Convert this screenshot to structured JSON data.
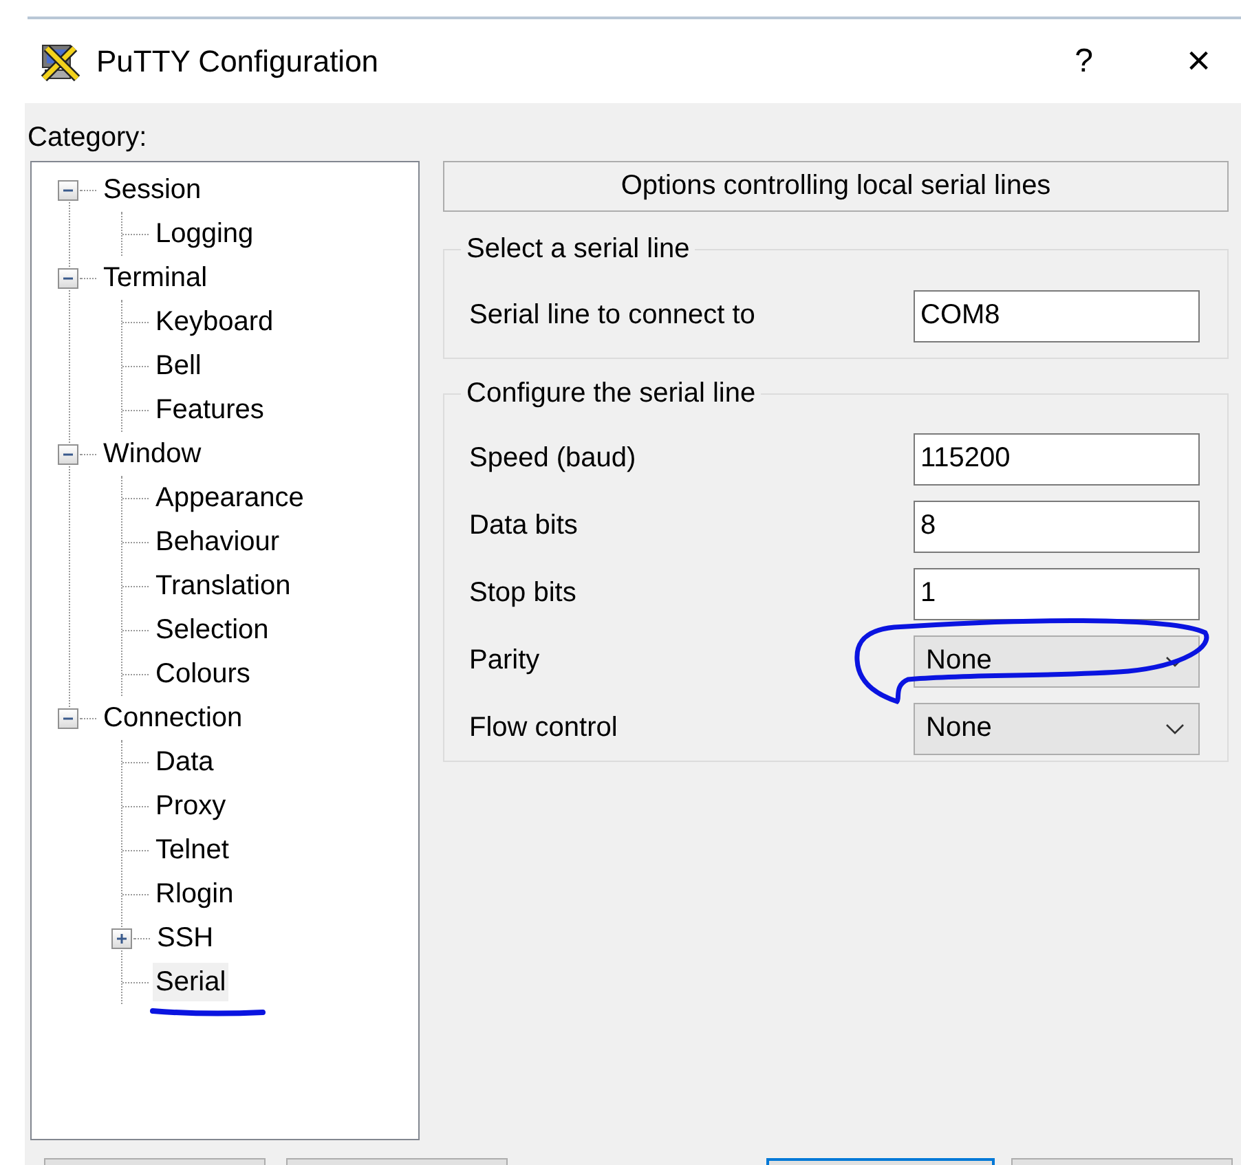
{
  "window": {
    "title": "PuTTY Configuration",
    "help": "?",
    "close": "×"
  },
  "category_label": "Category:",
  "tree": [
    {
      "label": "Session",
      "expanded": true,
      "selected": false,
      "underlined": false,
      "children": [
        {
          "label": "Logging",
          "selected": false,
          "underlined": false
        }
      ]
    },
    {
      "label": "Terminal",
      "expanded": true,
      "selected": false,
      "underlined": false,
      "children": [
        {
          "label": "Keyboard",
          "selected": false,
          "underlined": false
        },
        {
          "label": "Bell",
          "selected": false,
          "underlined": false
        },
        {
          "label": "Features",
          "selected": false,
          "underlined": false
        }
      ]
    },
    {
      "label": "Window",
      "expanded": true,
      "selected": false,
      "underlined": false,
      "children": [
        {
          "label": "Appearance",
          "selected": false,
          "underlined": false
        },
        {
          "label": "Behaviour",
          "selected": false,
          "underlined": false
        },
        {
          "label": "Translation",
          "selected": false,
          "underlined": false
        },
        {
          "label": "Selection",
          "selected": false,
          "underlined": false
        },
        {
          "label": "Colours",
          "selected": false,
          "underlined": false
        }
      ]
    },
    {
      "label": "Connection",
      "expanded": true,
      "selected": false,
      "underlined": false,
      "children": [
        {
          "label": "Data",
          "selected": false,
          "underlined": false
        },
        {
          "label": "Proxy",
          "selected": false,
          "underlined": false
        },
        {
          "label": "Telnet",
          "selected": false,
          "underlined": false
        },
        {
          "label": "Rlogin",
          "selected": false,
          "underlined": false
        },
        {
          "label": "SSH",
          "expanded": false,
          "selected": false,
          "underlined": false
        },
        {
          "label": "Serial",
          "selected": true,
          "underlined": true
        }
      ]
    }
  ],
  "panel": {
    "header": "Options controlling local serial lines",
    "groups": [
      {
        "title": "Select a serial line",
        "rows": [
          {
            "kind": "text",
            "label": "Serial line to connect to",
            "value": "COM8",
            "circled": false
          }
        ]
      },
      {
        "title": "Configure the serial line",
        "rows": [
          {
            "kind": "text",
            "label": "Speed (baud)",
            "value": "115200",
            "circled": false
          },
          {
            "kind": "text",
            "label": "Data bits",
            "value": "8",
            "circled": false
          },
          {
            "kind": "text",
            "label": "Stop bits",
            "value": "1",
            "circled": false
          },
          {
            "kind": "dropdown",
            "label": "Parity",
            "value": "None",
            "circled": true
          },
          {
            "kind": "dropdown",
            "label": "Flow control",
            "value": "None",
            "circled": false
          }
        ]
      }
    ]
  },
  "buttons": [
    {
      "default": false
    },
    {
      "default": false
    },
    {
      "default": true
    },
    {
      "default": false
    }
  ]
}
